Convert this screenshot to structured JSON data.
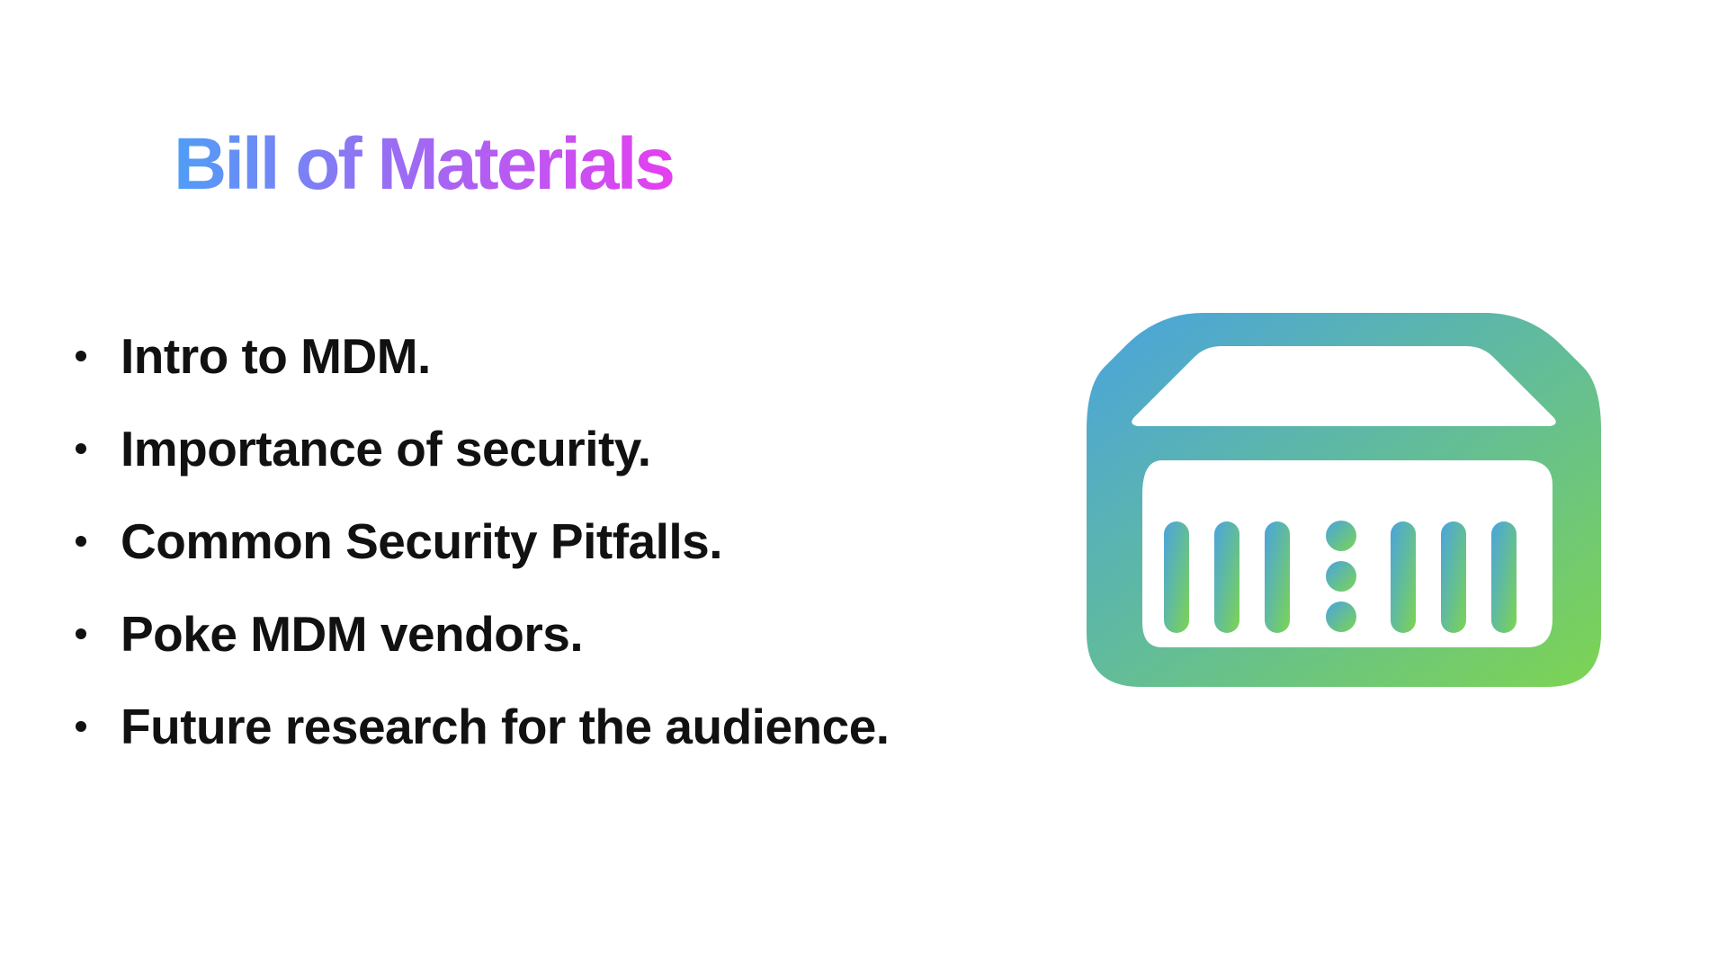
{
  "slide": {
    "title": "Bill of Materials",
    "title_gradient": [
      "#4f9ef6",
      "#9b6cf3",
      "#e53ff0"
    ],
    "bullets": [
      "Intro to MDM.",
      "Importance of security.",
      "Common Security Pitfalls.",
      "Poke MDM vendors.",
      "Future research for the audience."
    ],
    "icon": {
      "name": "server-icon",
      "gradient": [
        "#4aa3de",
        "#62bc9a",
        "#7dd452"
      ]
    }
  }
}
